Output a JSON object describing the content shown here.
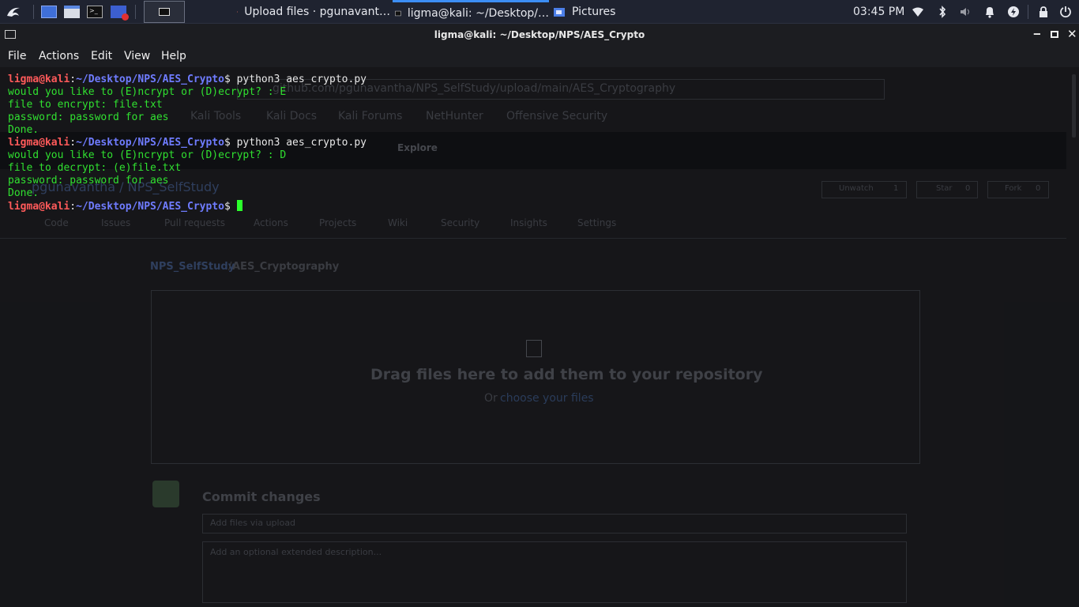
{
  "panel": {
    "tasks": [
      {
        "label": "Upload files · pgunavant…",
        "icon": "firefox-icon"
      },
      {
        "label": "ligma@kali: ~/Desktop/…",
        "icon": "terminal-icon"
      },
      {
        "label": "Pictures",
        "icon": "folder-icon"
      }
    ],
    "clock": "03:45 PM"
  },
  "window": {
    "title": "ligma@kali: ~/Desktop/NPS/AES_Crypto",
    "menu": [
      "File",
      "Actions",
      "Edit",
      "View",
      "Help"
    ]
  },
  "terminal": {
    "user": "ligma@kali",
    "path": "~/Desktop/NPS/AES_Crypto",
    "lines": [
      {
        "type": "prompt",
        "command": "python3 aes_crypto.py"
      },
      {
        "type": "out",
        "text": "would you like to (E)ncrypt or (D)ecrypt? : E"
      },
      {
        "type": "out",
        "text": "file to encrypt: file.txt"
      },
      {
        "type": "out",
        "text": "password: password for aes"
      },
      {
        "type": "out",
        "text": "Done."
      },
      {
        "type": "prompt",
        "command": "python3 aes_crypto.py"
      },
      {
        "type": "out",
        "text": "would you like to (E)ncrypt or (D)ecrypt? : D"
      },
      {
        "type": "out",
        "text": "file to decrypt: (e)file.txt"
      },
      {
        "type": "out",
        "text": "password: password for aes"
      },
      {
        "type": "out",
        "text": "Done."
      },
      {
        "type": "prompt",
        "command": ""
      }
    ]
  },
  "background": {
    "url": "github.com/pgunavantha/NPS_SelfStudy/upload/main/AES_Cryptography",
    "bookmarks": [
      "Kali Tools",
      "Kali Docs",
      "Kali Forums",
      "NetHunter",
      "Offensive Security"
    ],
    "nav": "Explore",
    "repo": "pgunavantha / NPS_SelfStudy",
    "repo_tabs": [
      "Code",
      "Issues",
      "Pull requests",
      "Actions",
      "Projects",
      "Wiki",
      "Security",
      "Insights",
      "Settings"
    ],
    "watch": "Unwatch",
    "watch_count": "1",
    "star": "Star",
    "star_count": "0",
    "fork": "Fork",
    "fork_count": "0",
    "breadcrumb_repo": "NPS_SelfStudy",
    "breadcrumb_dir": "AES_Cryptography",
    "drop_heading": "Drag files here to add them to your repository",
    "drop_or": "Or",
    "drop_link": "choose your files",
    "commit_heading": "Commit changes",
    "commit_placeholder": "Add files via upload",
    "desc_placeholder": "Add an optional extended description..."
  }
}
